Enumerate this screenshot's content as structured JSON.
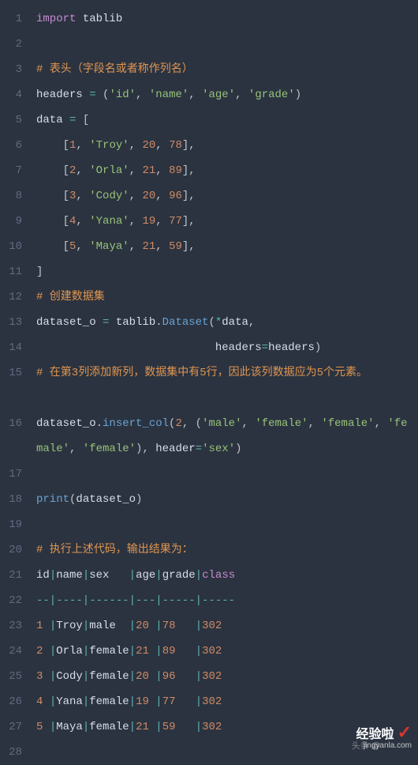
{
  "lines": [
    {
      "n": "1",
      "h": 1,
      "tokens": [
        {
          "c": "kw",
          "t": "import"
        },
        {
          "c": "plain",
          "t": " "
        },
        {
          "c": "mod",
          "t": "tablib"
        }
      ]
    },
    {
      "n": "2",
      "h": 1,
      "tokens": []
    },
    {
      "n": "3",
      "h": 1,
      "tokens": [
        {
          "c": "cmt-hl",
          "t": "# 表头（字段名或者称作列名）"
        }
      ]
    },
    {
      "n": "4",
      "h": 1,
      "tokens": [
        {
          "c": "var",
          "t": "headers "
        },
        {
          "c": "op",
          "t": "="
        },
        {
          "c": "plain",
          "t": " "
        },
        {
          "c": "punc",
          "t": "("
        },
        {
          "c": "str",
          "t": "'id'"
        },
        {
          "c": "punc",
          "t": ", "
        },
        {
          "c": "str",
          "t": "'name'"
        },
        {
          "c": "punc",
          "t": ", "
        },
        {
          "c": "str",
          "t": "'age'"
        },
        {
          "c": "punc",
          "t": ", "
        },
        {
          "c": "str",
          "t": "'grade'"
        },
        {
          "c": "punc",
          "t": ")"
        }
      ]
    },
    {
      "n": "5",
      "h": 1,
      "tokens": [
        {
          "c": "var",
          "t": "data "
        },
        {
          "c": "op",
          "t": "="
        },
        {
          "c": "plain",
          "t": " "
        },
        {
          "c": "punc",
          "t": "["
        }
      ]
    },
    {
      "n": "6",
      "h": 1,
      "tokens": [
        {
          "c": "plain",
          "t": "    "
        },
        {
          "c": "punc",
          "t": "["
        },
        {
          "c": "num",
          "t": "1"
        },
        {
          "c": "punc",
          "t": ", "
        },
        {
          "c": "str",
          "t": "'Troy'"
        },
        {
          "c": "punc",
          "t": ", "
        },
        {
          "c": "num",
          "t": "20"
        },
        {
          "c": "punc",
          "t": ", "
        },
        {
          "c": "num",
          "t": "78"
        },
        {
          "c": "punc",
          "t": "],"
        }
      ]
    },
    {
      "n": "7",
      "h": 1,
      "tokens": [
        {
          "c": "plain",
          "t": "    "
        },
        {
          "c": "punc",
          "t": "["
        },
        {
          "c": "num",
          "t": "2"
        },
        {
          "c": "punc",
          "t": ", "
        },
        {
          "c": "str",
          "t": "'Orla'"
        },
        {
          "c": "punc",
          "t": ", "
        },
        {
          "c": "num",
          "t": "21"
        },
        {
          "c": "punc",
          "t": ", "
        },
        {
          "c": "num",
          "t": "89"
        },
        {
          "c": "punc",
          "t": "],"
        }
      ]
    },
    {
      "n": "8",
      "h": 1,
      "tokens": [
        {
          "c": "plain",
          "t": "    "
        },
        {
          "c": "punc",
          "t": "["
        },
        {
          "c": "num",
          "t": "3"
        },
        {
          "c": "punc",
          "t": ", "
        },
        {
          "c": "str",
          "t": "'Cody'"
        },
        {
          "c": "punc",
          "t": ", "
        },
        {
          "c": "num",
          "t": "20"
        },
        {
          "c": "punc",
          "t": ", "
        },
        {
          "c": "num",
          "t": "96"
        },
        {
          "c": "punc",
          "t": "],"
        }
      ]
    },
    {
      "n": "9",
      "h": 1,
      "tokens": [
        {
          "c": "plain",
          "t": "    "
        },
        {
          "c": "punc",
          "t": "["
        },
        {
          "c": "num",
          "t": "4"
        },
        {
          "c": "punc",
          "t": ", "
        },
        {
          "c": "str",
          "t": "'Yana'"
        },
        {
          "c": "punc",
          "t": ", "
        },
        {
          "c": "num",
          "t": "19"
        },
        {
          "c": "punc",
          "t": ", "
        },
        {
          "c": "num",
          "t": "77"
        },
        {
          "c": "punc",
          "t": "],"
        }
      ]
    },
    {
      "n": "10",
      "h": 1,
      "tokens": [
        {
          "c": "plain",
          "t": "    "
        },
        {
          "c": "punc",
          "t": "["
        },
        {
          "c": "num",
          "t": "5"
        },
        {
          "c": "punc",
          "t": ", "
        },
        {
          "c": "str",
          "t": "'Maya'"
        },
        {
          "c": "punc",
          "t": ", "
        },
        {
          "c": "num",
          "t": "21"
        },
        {
          "c": "punc",
          "t": ", "
        },
        {
          "c": "num",
          "t": "59"
        },
        {
          "c": "punc",
          "t": "],"
        }
      ]
    },
    {
      "n": "11",
      "h": 1,
      "tokens": [
        {
          "c": "punc",
          "t": "]"
        }
      ]
    },
    {
      "n": "12",
      "h": 1,
      "tokens": [
        {
          "c": "cmt-hl",
          "t": "# 创建数据集"
        }
      ]
    },
    {
      "n": "13",
      "h": 1,
      "tokens": [
        {
          "c": "var",
          "t": "dataset_o "
        },
        {
          "c": "op",
          "t": "="
        },
        {
          "c": "plain",
          "t": " "
        },
        {
          "c": "var",
          "t": "tablib"
        },
        {
          "c": "punc",
          "t": "."
        },
        {
          "c": "fn",
          "t": "Dataset"
        },
        {
          "c": "punc",
          "t": "("
        },
        {
          "c": "op",
          "t": "*"
        },
        {
          "c": "var",
          "t": "data"
        },
        {
          "c": "punc",
          "t": ","
        }
      ]
    },
    {
      "n": "14",
      "h": 1,
      "tokens": [
        {
          "c": "plain",
          "t": "                           "
        },
        {
          "c": "param",
          "t": "headers"
        },
        {
          "c": "op",
          "t": "="
        },
        {
          "c": "var",
          "t": "headers"
        },
        {
          "c": "punc",
          "t": ")"
        }
      ]
    },
    {
      "n": "15",
      "h": 2,
      "tokens": [
        {
          "c": "cmt-hl",
          "t": "# 在第3列添加新列，数据集中有5行，因此该列数据应为5个元素。"
        }
      ]
    },
    {
      "n": "16",
      "h": 2,
      "tokens": [
        {
          "c": "var",
          "t": "dataset_o"
        },
        {
          "c": "punc",
          "t": "."
        },
        {
          "c": "fn",
          "t": "insert_col"
        },
        {
          "c": "punc",
          "t": "("
        },
        {
          "c": "num",
          "t": "2"
        },
        {
          "c": "punc",
          "t": ", ("
        },
        {
          "c": "str",
          "t": "'male'"
        },
        {
          "c": "punc",
          "t": ", "
        },
        {
          "c": "str",
          "t": "'female'"
        },
        {
          "c": "punc",
          "t": ", "
        },
        {
          "c": "str",
          "t": "'female'"
        },
        {
          "c": "punc",
          "t": ", "
        },
        {
          "c": "str",
          "t": "'female'"
        },
        {
          "c": "punc",
          "t": ", "
        },
        {
          "c": "str",
          "t": "'female'"
        },
        {
          "c": "punc",
          "t": "), "
        },
        {
          "c": "param",
          "t": "header"
        },
        {
          "c": "op",
          "t": "="
        },
        {
          "c": "str",
          "t": "'sex'"
        },
        {
          "c": "punc",
          "t": ")"
        }
      ]
    },
    {
      "n": "17",
      "h": 1,
      "tokens": []
    },
    {
      "n": "18",
      "h": 1,
      "tokens": [
        {
          "c": "fn",
          "t": "print"
        },
        {
          "c": "punc",
          "t": "("
        },
        {
          "c": "var",
          "t": "dataset_o"
        },
        {
          "c": "punc",
          "t": ")"
        }
      ]
    },
    {
      "n": "19",
      "h": 1,
      "tokens": []
    },
    {
      "n": "20",
      "h": 1,
      "tokens": [
        {
          "c": "cmt-hl",
          "t": "# 执行上述代码，输出结果为："
        }
      ]
    },
    {
      "n": "21",
      "h": 1,
      "tokens": [
        {
          "c": "var",
          "t": "id"
        },
        {
          "c": "op",
          "t": "|"
        },
        {
          "c": "var",
          "t": "name"
        },
        {
          "c": "op",
          "t": "|"
        },
        {
          "c": "var",
          "t": "sex   "
        },
        {
          "c": "op",
          "t": "|"
        },
        {
          "c": "var",
          "t": "age"
        },
        {
          "c": "op",
          "t": "|"
        },
        {
          "c": "var",
          "t": "grade"
        },
        {
          "c": "op",
          "t": "|"
        },
        {
          "c": "kw",
          "t": "class"
        }
      ]
    },
    {
      "n": "22",
      "h": 1,
      "tokens": [
        {
          "c": "op",
          "t": "--|----|------|---|-----|-----"
        }
      ]
    },
    {
      "n": "23",
      "h": 1,
      "tokens": [
        {
          "c": "num",
          "t": "1"
        },
        {
          "c": "plain",
          "t": " "
        },
        {
          "c": "op",
          "t": "|"
        },
        {
          "c": "var",
          "t": "Troy"
        },
        {
          "c": "op",
          "t": "|"
        },
        {
          "c": "var",
          "t": "male  "
        },
        {
          "c": "op",
          "t": "|"
        },
        {
          "c": "num",
          "t": "20"
        },
        {
          "c": "plain",
          "t": " "
        },
        {
          "c": "op",
          "t": "|"
        },
        {
          "c": "num",
          "t": "78"
        },
        {
          "c": "plain",
          "t": "   "
        },
        {
          "c": "op",
          "t": "|"
        },
        {
          "c": "num",
          "t": "302"
        }
      ]
    },
    {
      "n": "24",
      "h": 1,
      "tokens": [
        {
          "c": "num",
          "t": "2"
        },
        {
          "c": "plain",
          "t": " "
        },
        {
          "c": "op",
          "t": "|"
        },
        {
          "c": "var",
          "t": "Orla"
        },
        {
          "c": "op",
          "t": "|"
        },
        {
          "c": "var",
          "t": "female"
        },
        {
          "c": "op",
          "t": "|"
        },
        {
          "c": "num",
          "t": "21"
        },
        {
          "c": "plain",
          "t": " "
        },
        {
          "c": "op",
          "t": "|"
        },
        {
          "c": "num",
          "t": "89"
        },
        {
          "c": "plain",
          "t": "   "
        },
        {
          "c": "op",
          "t": "|"
        },
        {
          "c": "num",
          "t": "302"
        }
      ]
    },
    {
      "n": "25",
      "h": 1,
      "tokens": [
        {
          "c": "num",
          "t": "3"
        },
        {
          "c": "plain",
          "t": " "
        },
        {
          "c": "op",
          "t": "|"
        },
        {
          "c": "var",
          "t": "Cody"
        },
        {
          "c": "op",
          "t": "|"
        },
        {
          "c": "var",
          "t": "female"
        },
        {
          "c": "op",
          "t": "|"
        },
        {
          "c": "num",
          "t": "20"
        },
        {
          "c": "plain",
          "t": " "
        },
        {
          "c": "op",
          "t": "|"
        },
        {
          "c": "num",
          "t": "96"
        },
        {
          "c": "plain",
          "t": "   "
        },
        {
          "c": "op",
          "t": "|"
        },
        {
          "c": "num",
          "t": "302"
        }
      ]
    },
    {
      "n": "26",
      "h": 1,
      "tokens": [
        {
          "c": "num",
          "t": "4"
        },
        {
          "c": "plain",
          "t": " "
        },
        {
          "c": "op",
          "t": "|"
        },
        {
          "c": "var",
          "t": "Yana"
        },
        {
          "c": "op",
          "t": "|"
        },
        {
          "c": "var",
          "t": "female"
        },
        {
          "c": "op",
          "t": "|"
        },
        {
          "c": "num",
          "t": "19"
        },
        {
          "c": "plain",
          "t": " "
        },
        {
          "c": "op",
          "t": "|"
        },
        {
          "c": "num",
          "t": "77"
        },
        {
          "c": "plain",
          "t": "   "
        },
        {
          "c": "op",
          "t": "|"
        },
        {
          "c": "num",
          "t": "302"
        }
      ]
    },
    {
      "n": "27",
      "h": 1,
      "tokens": [
        {
          "c": "num",
          "t": "5"
        },
        {
          "c": "plain",
          "t": " "
        },
        {
          "c": "op",
          "t": "|"
        },
        {
          "c": "var",
          "t": "Maya"
        },
        {
          "c": "op",
          "t": "|"
        },
        {
          "c": "var",
          "t": "female"
        },
        {
          "c": "op",
          "t": "|"
        },
        {
          "c": "num",
          "t": "21"
        },
        {
          "c": "plain",
          "t": " "
        },
        {
          "c": "op",
          "t": "|"
        },
        {
          "c": "num",
          "t": "59"
        },
        {
          "c": "plain",
          "t": "   "
        },
        {
          "c": "op",
          "t": "|"
        },
        {
          "c": "num",
          "t": "302"
        }
      ]
    },
    {
      "n": "28",
      "h": 1,
      "tokens": []
    }
  ],
  "watermark": {
    "title": "经验啦",
    "url": "jingyanla.com",
    "toutiao": "头条 @"
  }
}
